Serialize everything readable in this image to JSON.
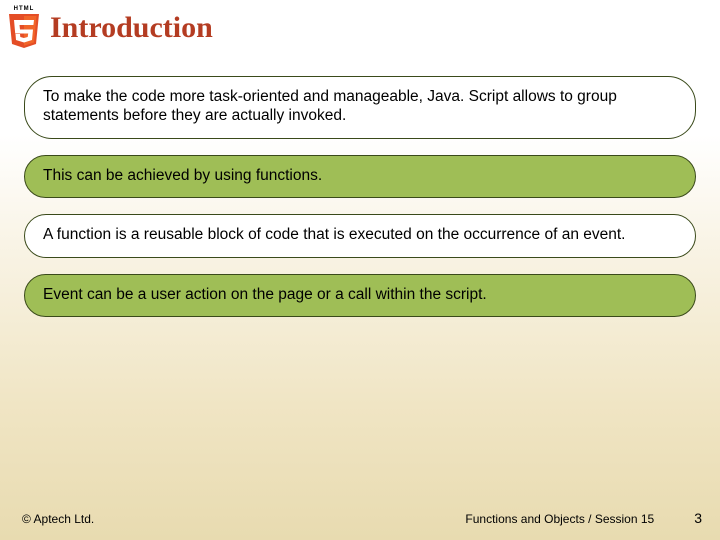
{
  "header": {
    "logo_label": "HTML",
    "title": "Introduction"
  },
  "bullets": [
    {
      "text": "To make the code more task-oriented and manageable, Java. Script allows to group statements before they are actually invoked.",
      "variant": "white"
    },
    {
      "text": "This can be achieved by using functions.",
      "variant": "green"
    },
    {
      "text": "A function is a reusable block of code that is executed on the occurrence of an event.",
      "variant": "white"
    },
    {
      "text": "Event can be a user action on the page or a call within the script.",
      "variant": "green"
    }
  ],
  "footer": {
    "copyright": "© Aptech Ltd.",
    "session": "Functions and Objects / Session 15",
    "page": "3"
  }
}
